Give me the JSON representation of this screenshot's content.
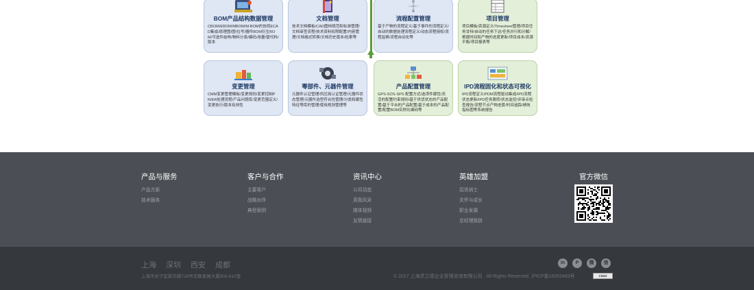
{
  "modules": {
    "row1": [
      {
        "title": "BOM产品结构数据管理",
        "desc": "CBOM/EBOM/MBOM/M-BOM的协同ECAD集成/原理图/图/位号/器件BOM衍生BOM/可选件结构/物料分类/编码/用量/替代料/版本"
      },
      {
        "title": "文档管理",
        "desc": "技术文档模板/CAD图档规范和标准管理/文档审签流程/技术资料权限配置/内容管理/文档格式转换/文档历史版本/检索等"
      },
      {
        "title": "流程配置管理",
        "desc": "基于产物的流程定义/基于事件的流程定义/自动的数据处理流程定义/动态流程授权/流程监察/流程自动化等"
      },
      {
        "title": "项目管理",
        "desc": "项目模板/资源定义/Timesheet管理/项目任务甘特/自动的任务下达/任务并行和分解/根据时间和产物的进度更新/项目成本/资源平衡/项目报表等"
      }
    ],
    "row2": [
      {
        "title": "变更管理",
        "desc": "CMM变更管理模板/变更规则/变更控制PR/ER处理流程/产品问题库/变更范围定义/变更执行/版本有效性"
      },
      {
        "title": "零部件、元器件管理",
        "desc": "元器件认证管理/供应商认证管理/元器件状态管理/元器件选型符合性管理/分类和属性特征等库的管理/使用规则管理等"
      },
      {
        "title": "产品配置管理",
        "desc": "GPS-SOS-SPS 配置方式/选项件属性/灵活的配置约束规则/基于供货状态的产品配置/基于平台的产品配置/基于成本的产品配置/配置BOM实例化编码等"
      },
      {
        "title": "IPD流程固化和状态可视化",
        "desc": "IPD流程定义/PDM流程驱动集成/IPD流程状态更新/IPD任务跳转/状态监控/评审点检查报告/流程节点产物进度/时间追踪/绩效指标图等系统报告"
      }
    ]
  },
  "footer": {
    "columns": [
      {
        "head": "产品与服务",
        "links": [
          "产品方案",
          "技术服务"
        ]
      },
      {
        "head": "客户与合作",
        "links": [
          "主要客户",
          "战略伙伴",
          "典型案例"
        ]
      },
      {
        "head": "资讯中心",
        "links": [
          "公司动态",
          "真我风采",
          "媒体视频",
          "友情链接"
        ]
      },
      {
        "head": "英雄加盟",
        "links": [
          "招贤纳士",
          "关怀与成长",
          "职业发展",
          "总经理致辞"
        ]
      }
    ],
    "wechat_title": "官方微信",
    "cities": [
      "上海",
      "深圳",
      "西安",
      "成都"
    ],
    "address": "上海市长宁区新华路728号华联发展大厦808-810室",
    "copyright": "© 2017 上海贯立德企业管理咨询有限公司 . All Rights Reserved. 沪ICP备16053493号",
    "cnzz": "CNZZ",
    "social": [
      {
        "icon": "linkedin-icon",
        "glyph": "in"
      },
      {
        "icon": "pinterest-icon",
        "glyph": "P"
      },
      {
        "icon": "weibo-icon",
        "glyph": "微"
      },
      {
        "icon": "wechat-icon",
        "glyph": "信"
      }
    ]
  },
  "colors": {
    "accent_blue": "#1f3a63",
    "card_blue": "#dfe6f4",
    "card_green": "#e3efd9",
    "arrow_green": "#5c9c3a",
    "footer": "#4b4f55",
    "footer_bottom": "#35383c"
  }
}
